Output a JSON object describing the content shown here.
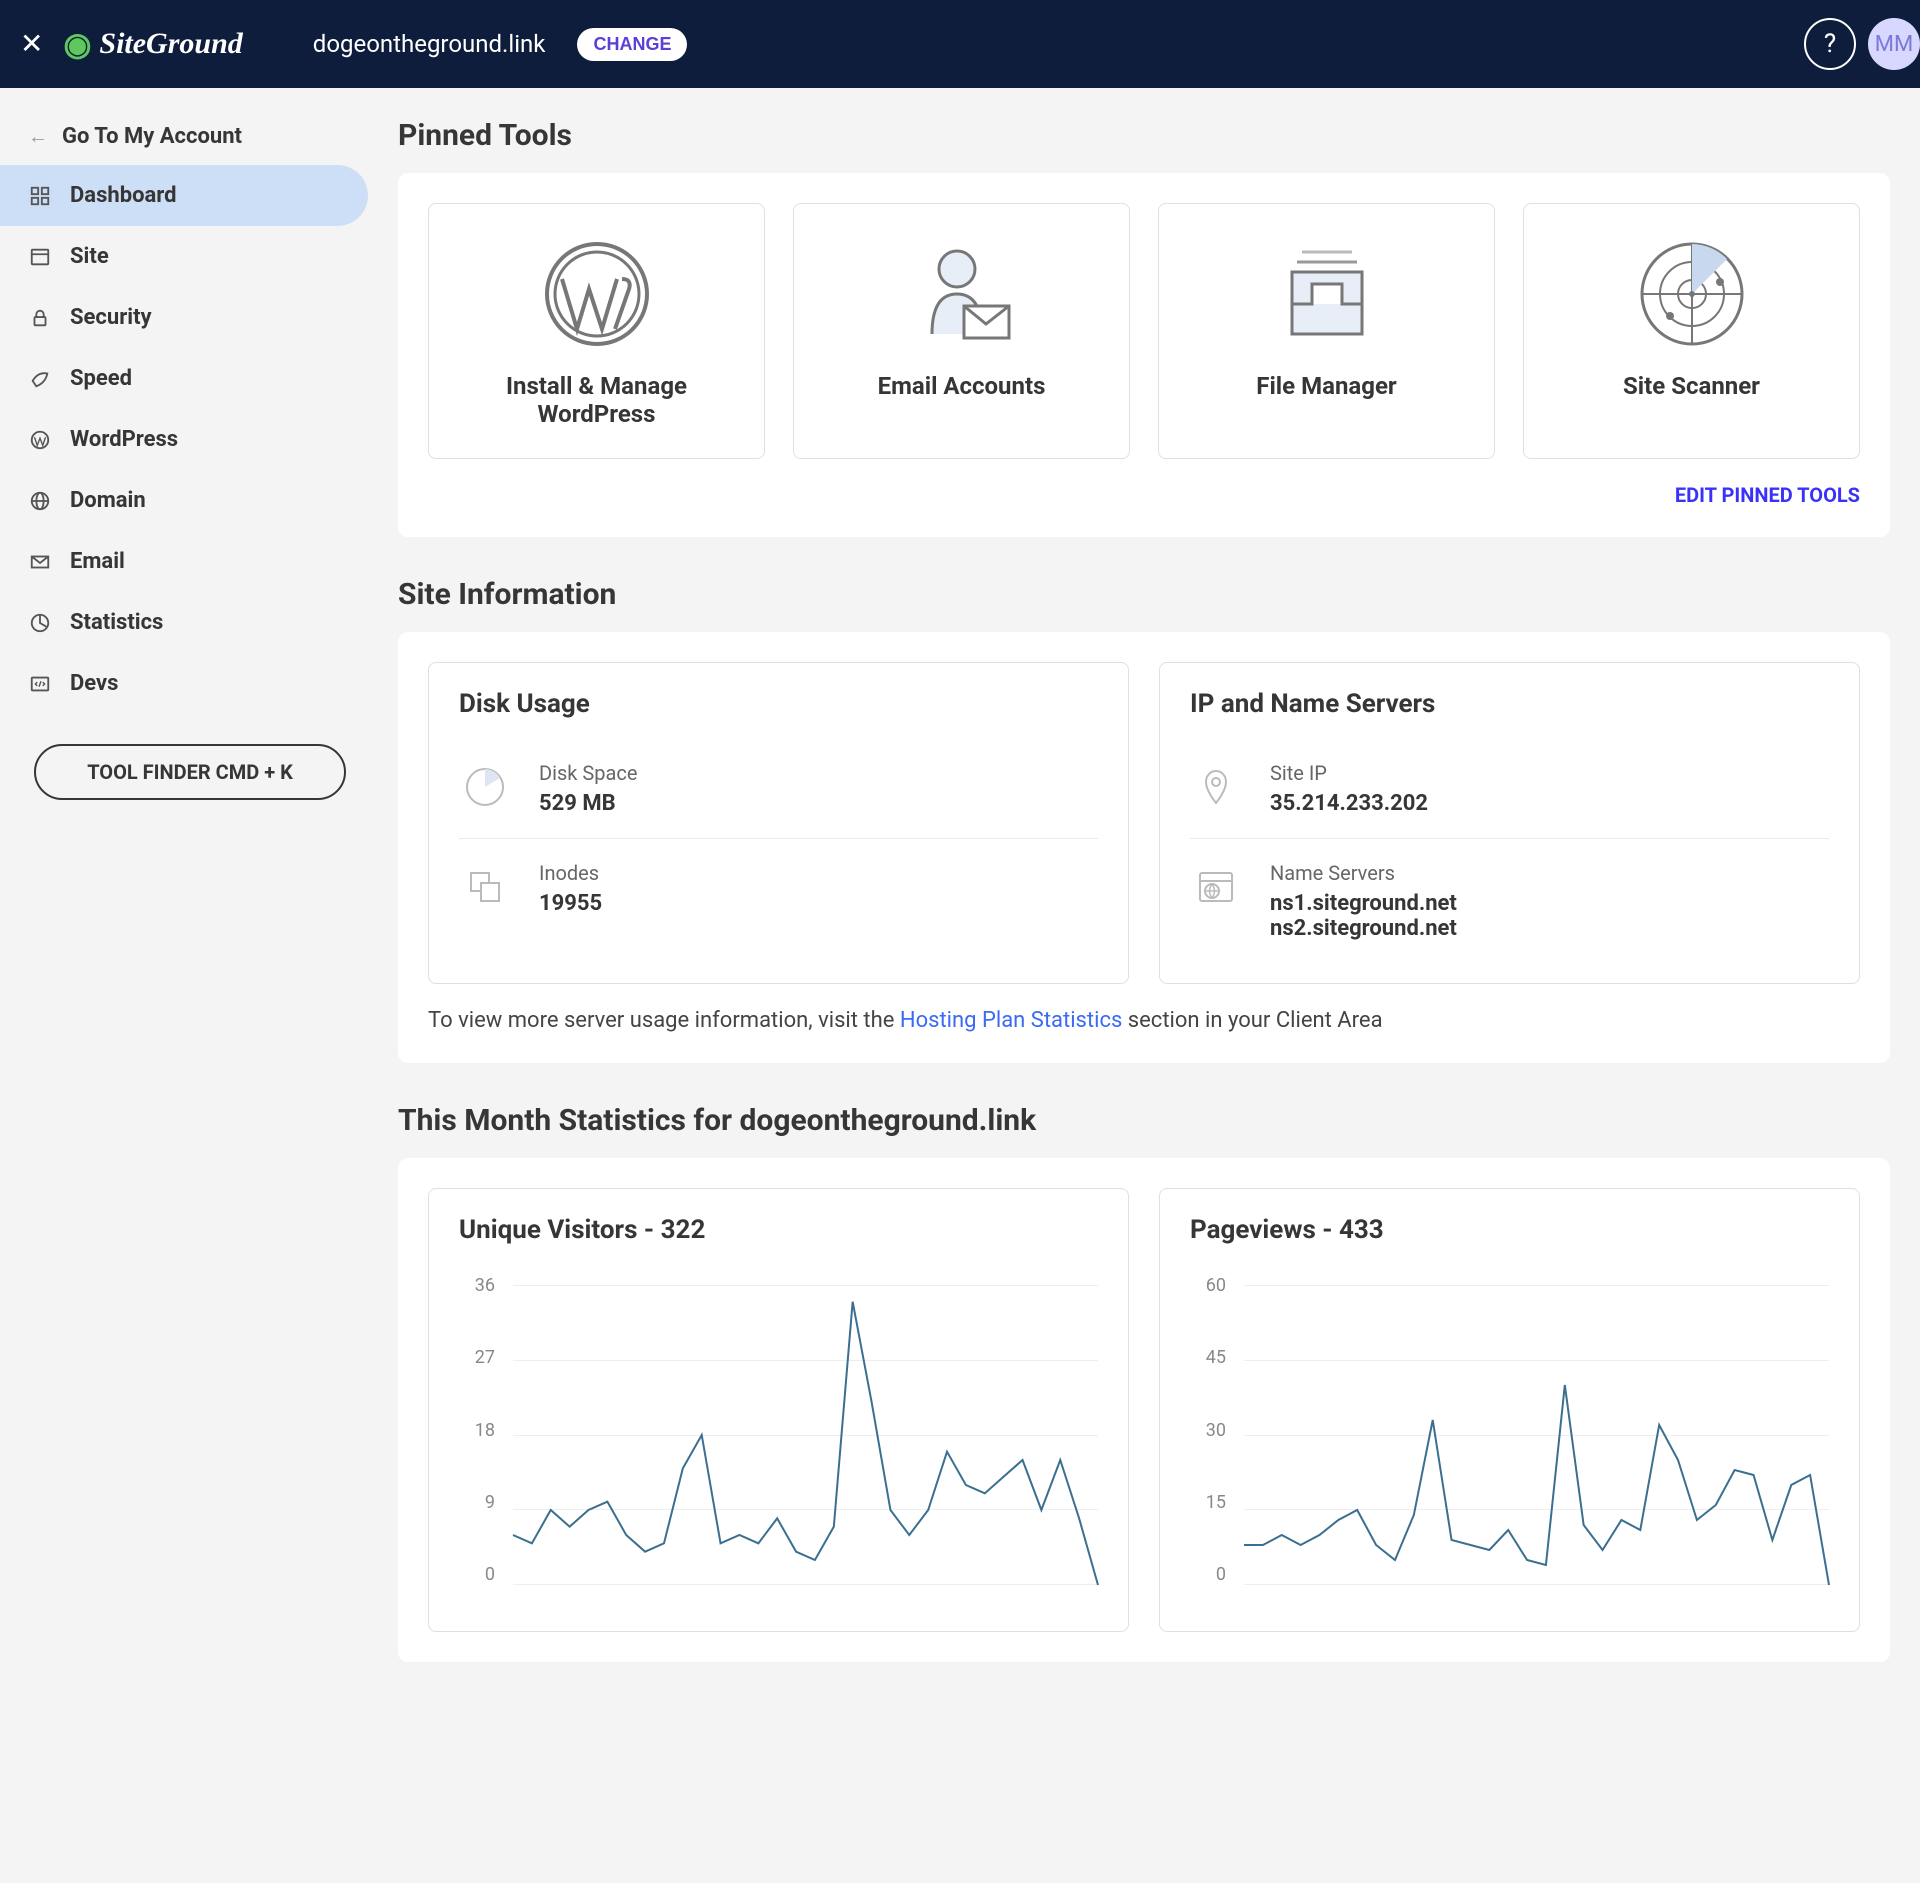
{
  "header": {
    "logo_text": "SiteGround",
    "domain": "dogeontheground.link",
    "change_btn": "CHANGE",
    "avatar_initials": "MM"
  },
  "sidebar": {
    "go_back": "Go To My Account",
    "items": [
      {
        "label": "Dashboard",
        "icon": "dashboard",
        "active": true
      },
      {
        "label": "Site",
        "icon": "site",
        "active": false
      },
      {
        "label": "Security",
        "icon": "security",
        "active": false
      },
      {
        "label": "Speed",
        "icon": "speed",
        "active": false
      },
      {
        "label": "WordPress",
        "icon": "wordpress",
        "active": false
      },
      {
        "label": "Domain",
        "icon": "domain",
        "active": false
      },
      {
        "label": "Email",
        "icon": "email",
        "active": false
      },
      {
        "label": "Statistics",
        "icon": "statistics",
        "active": false
      },
      {
        "label": "Devs",
        "icon": "devs",
        "active": false
      }
    ],
    "tool_finder": "TOOL FINDER CMD + K"
  },
  "pinned": {
    "title": "Pinned Tools",
    "tools": [
      {
        "label": "Install & Manage WordPress"
      },
      {
        "label": "Email Accounts"
      },
      {
        "label": "File Manager"
      },
      {
        "label": "Site Scanner"
      }
    ],
    "edit_link": "EDIT PINNED TOOLS"
  },
  "site_info": {
    "title": "Site Information",
    "disk": {
      "title": "Disk Usage",
      "space_label": "Disk Space",
      "space_value": "529 MB",
      "inodes_label": "Inodes",
      "inodes_value": "19955"
    },
    "ip": {
      "title": "IP and Name Servers",
      "ip_label": "Site IP",
      "ip_value": "35.214.233.202",
      "ns_label": "Name Servers",
      "ns1": "ns1.siteground.net",
      "ns2": "ns2.siteground.net"
    },
    "note_prefix": "To view more server usage information, visit the ",
    "note_link": "Hosting Plan Statistics",
    "note_suffix": " section in your Client Area"
  },
  "stats": {
    "title": "This Month Statistics for dogeontheground.link",
    "visitors": {
      "title": "Unique Visitors - 322"
    },
    "pageviews": {
      "title": "Pageviews - 433"
    }
  },
  "chart_data": [
    {
      "type": "line",
      "title": "Unique Visitors - 322",
      "ylim": [
        0,
        36
      ],
      "y_ticks": [
        36,
        27,
        18,
        9,
        0
      ],
      "values": [
        6,
        5,
        9,
        7,
        9,
        10,
        6,
        4,
        5,
        14,
        18,
        5,
        6,
        5,
        8,
        4,
        3,
        7,
        34,
        22,
        9,
        6,
        9,
        16,
        12,
        11,
        13,
        15,
        9,
        15,
        8,
        0
      ]
    },
    {
      "type": "line",
      "title": "Pageviews - 433",
      "ylim": [
        0,
        60
      ],
      "y_ticks": [
        60,
        45,
        30,
        15,
        0
      ],
      "values": [
        8,
        8,
        10,
        8,
        10,
        13,
        15,
        8,
        5,
        14,
        33,
        9,
        8,
        7,
        11,
        5,
        4,
        40,
        12,
        7,
        13,
        11,
        32,
        25,
        13,
        16,
        23,
        22,
        9,
        20,
        22,
        0
      ]
    }
  ]
}
